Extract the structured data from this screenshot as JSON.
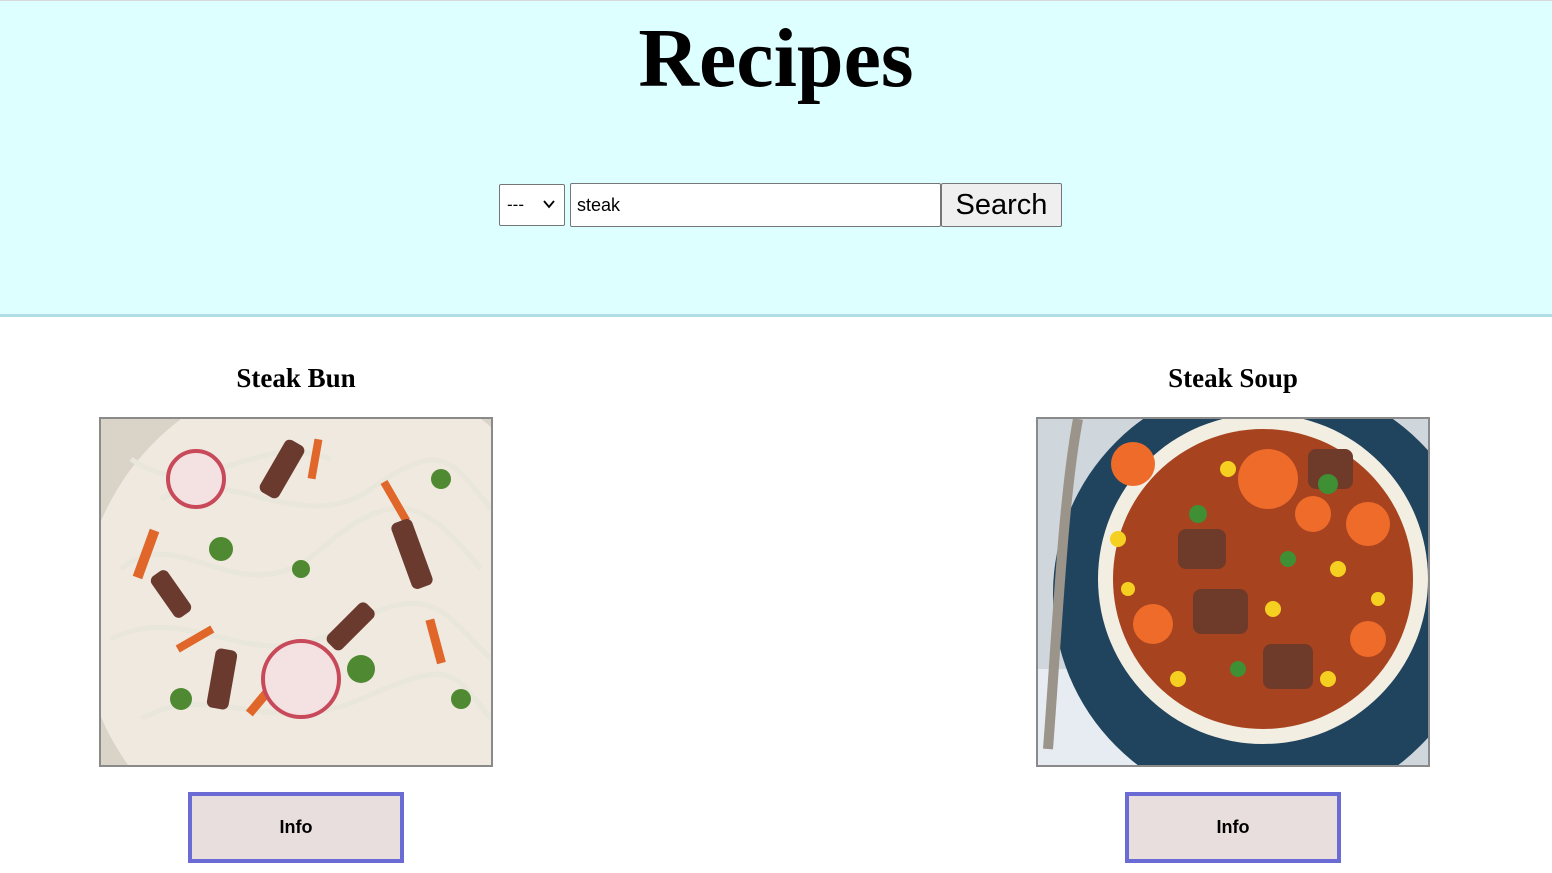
{
  "page": {
    "title": "Recipes"
  },
  "search": {
    "category_value": "---",
    "query_value": "steak",
    "button_label": "Search"
  },
  "recipes": [
    {
      "name": "Steak Bun",
      "info_label": "Info",
      "image": "noodle-salad-photo"
    },
    {
      "name": "Steak Soup",
      "info_label": "Info",
      "image": "stew-bowl-photo"
    }
  ],
  "colors": {
    "header_bg": "#ddffff",
    "header_border": "#b0dde6",
    "info_button_bg": "#e8dede",
    "info_button_border": "#6b6bd6"
  }
}
